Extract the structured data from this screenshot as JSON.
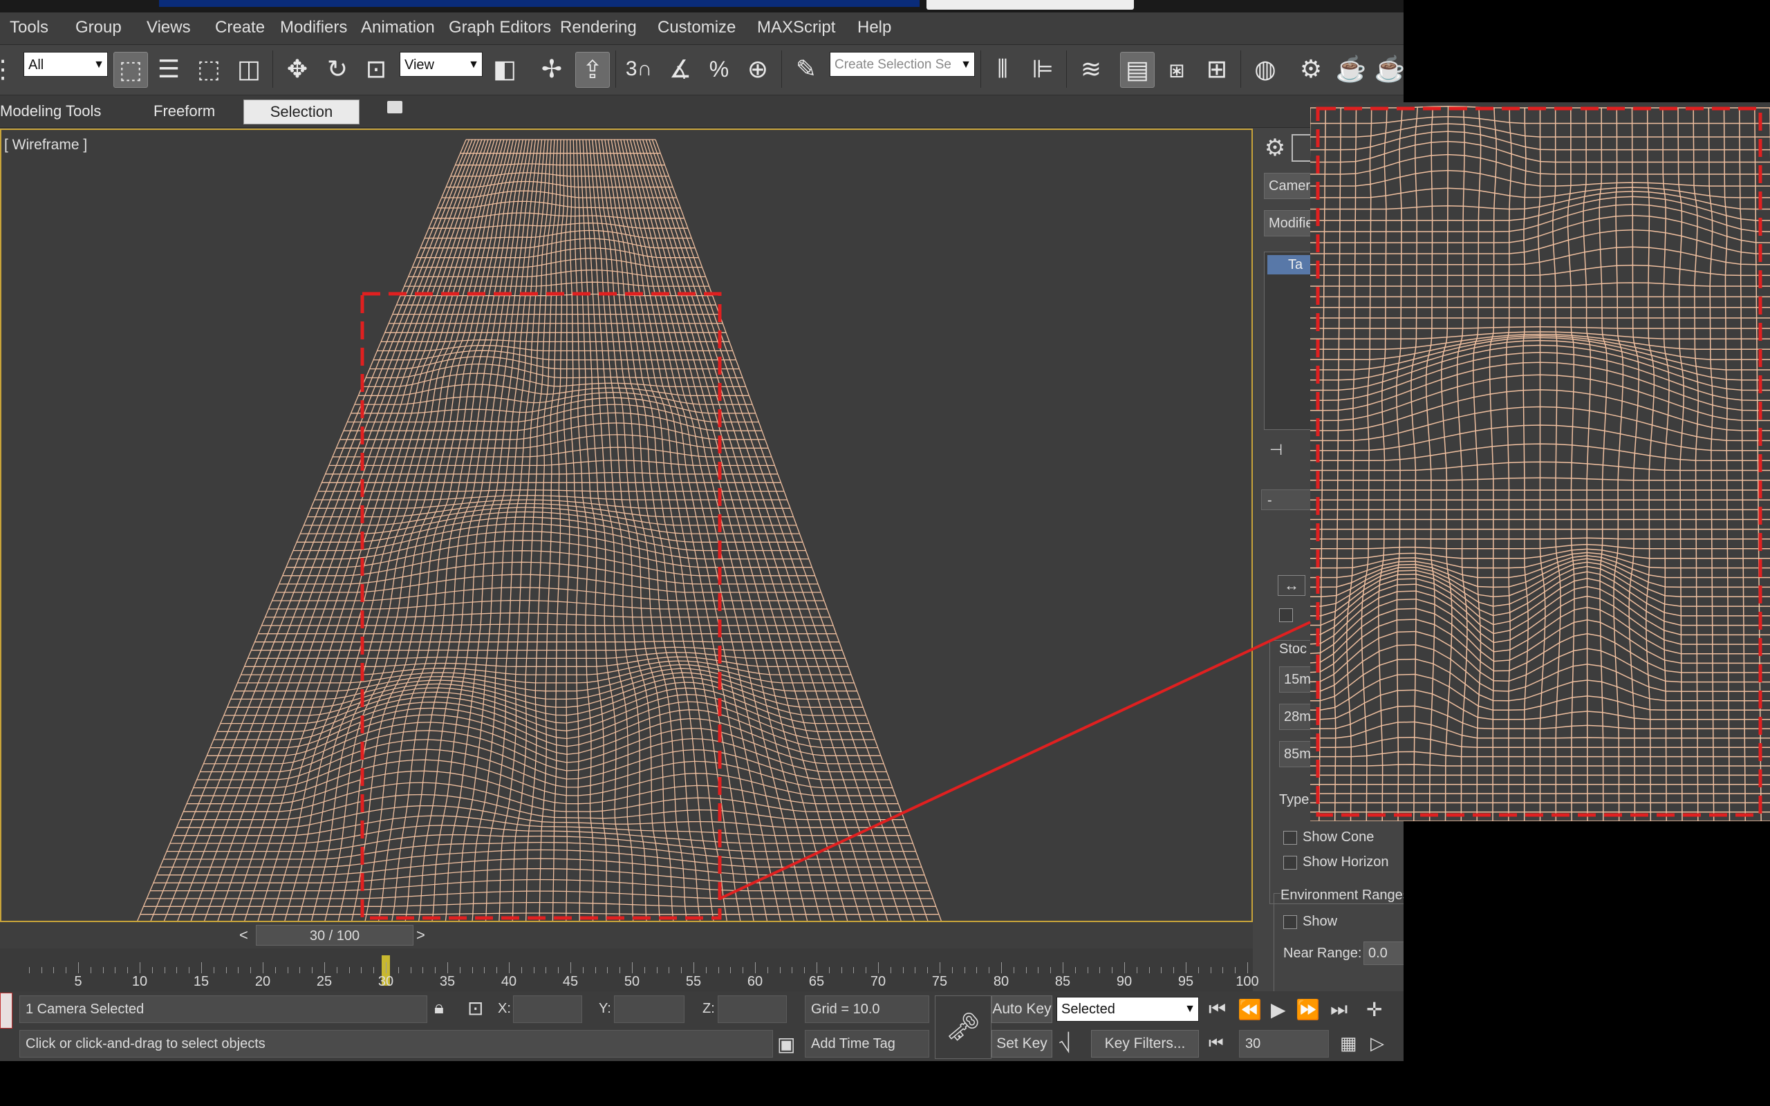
{
  "menu": [
    "Tools",
    "Group",
    "Views",
    "Create",
    "Modifiers",
    "Animation",
    "Graph Editors",
    "Rendering",
    "Customize",
    "MAXScript",
    "Help"
  ],
  "toolbar": {
    "filter_value": "All",
    "ref_coord_value": "View",
    "snap_angle_glyph": "3",
    "percent_glyph": "%",
    "selection_set_placeholder": "Create Selection Se"
  },
  "ribbon": {
    "tabs": [
      "Modeling Tools",
      "Freeform",
      "Selection"
    ],
    "active_tab": "Selection"
  },
  "viewport": {
    "label": "[ Wireframe ]",
    "mesh_color": "#f0c0a0",
    "highlight_color": "#e02020"
  },
  "command_panel": {
    "name_field": "Camera",
    "modifier_field": "Modifier",
    "list_item": "Ta",
    "stock_group": "Stoc",
    "lens_buttons": [
      "15m",
      "28m",
      "85m"
    ],
    "type_label": "Type",
    "show_cone": "Show Cone",
    "show_horizon": "Show Horizon",
    "env_group": "Environment Ranges",
    "env_show": "Show",
    "near_range_label": "Near Range:",
    "near_range_value": "0.0",
    "rollout_minus": "-"
  },
  "timeline": {
    "slider_label": "30 / 100",
    "prev": "<",
    "next": ">",
    "current_frame": 30,
    "max_frame": 100,
    "ticks": [
      "5",
      "10",
      "15",
      "20",
      "25",
      "30",
      "35",
      "40",
      "45",
      "50",
      "55",
      "60",
      "65",
      "70",
      "75",
      "80",
      "85",
      "90",
      "95",
      "100"
    ]
  },
  "status": {
    "selection_text": "1 Camera Selected",
    "prompt_text": "Click or click-and-drag to select objects",
    "x_label": "X:",
    "y_label": "Y:",
    "z_label": "Z:",
    "grid_text": "Grid = 10.0",
    "add_time_tag": "Add Time Tag",
    "auto_key": "Auto Key",
    "set_key": "Set Key",
    "key_mode_value": "Selected",
    "key_filters": "Key Filters...",
    "frame_field": "30"
  }
}
